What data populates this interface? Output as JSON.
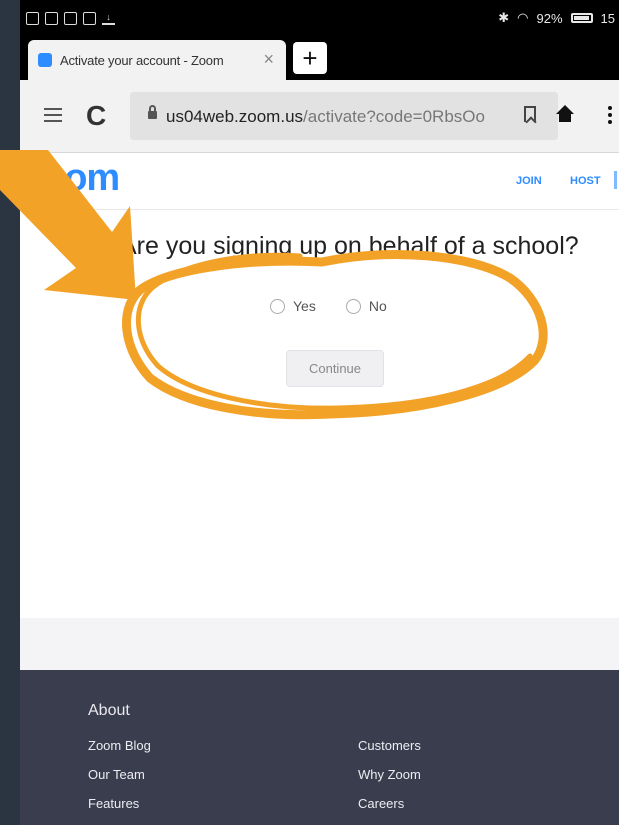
{
  "status_bar": {
    "battery": "92%",
    "time": "15"
  },
  "browser": {
    "tab_title": "Activate your account - Zoom",
    "tab_close": "×",
    "new_tab": "+",
    "url_host": "us04web.zoom.us",
    "url_path": "/activate?code=0RbsOo"
  },
  "site_header": {
    "logo": "zoom",
    "nav": [
      "JOIN",
      "HOST"
    ]
  },
  "form": {
    "question": "Are you signing up on behalf of a school?",
    "options": [
      "Yes",
      "No"
    ],
    "continue_label": "Continue"
  },
  "footer": {
    "heading": "About",
    "col1": [
      "Zoom Blog",
      "Our Team",
      "Features"
    ],
    "col2": [
      "Customers",
      "Why Zoom",
      "Careers"
    ]
  },
  "colors": {
    "zoom_blue": "#2d8cff",
    "annotation_orange": "#f2a227",
    "footer_bg": "#3a3d4d",
    "page_bg": "#2b3441"
  },
  "icons": [
    "reload-icon",
    "lock-icon",
    "bookmark-icon",
    "home-icon",
    "menu-icon",
    "more-icon",
    "bluetooth-icon",
    "wifi-icon",
    "battery-icon"
  ]
}
